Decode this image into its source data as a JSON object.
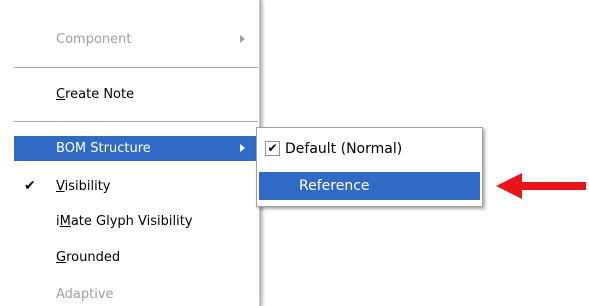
{
  "menu": {
    "items": [
      {
        "label_pre": "",
        "label_u": "",
        "label_post": "Component",
        "disabled": true,
        "submenu": true
      },
      {
        "label_pre": "",
        "label_u": "C",
        "label_post": "reate Note",
        "disabled": false
      },
      {
        "label": "BOM Structure",
        "highlighted": true,
        "submenu": true
      },
      {
        "label_pre": "",
        "label_u": "V",
        "label_post": "isibility",
        "checked": true,
        "check_glyph": "✔"
      },
      {
        "label_pre": "i",
        "label_u": "M",
        "label_post": "ate Glyph Visibility"
      },
      {
        "label_pre": "",
        "label_u": "G",
        "label_post": "rounded"
      },
      {
        "label_pre": "",
        "label_u": "",
        "label_post": "Adaptive",
        "disabled": true
      }
    ]
  },
  "submenu": {
    "items": [
      {
        "label": "Default (Normal)",
        "checked": true,
        "check_glyph": "✔"
      },
      {
        "label": "Reference",
        "highlighted": true
      }
    ]
  },
  "colors": {
    "highlight": "#316ac5",
    "disabled_text": "#a0a0a0",
    "arrow_red": "#e8141a"
  },
  "icons": {
    "submenu_arrow": "chevron-right-icon",
    "check": "checkmark-icon",
    "annotation": "red-arrow-icon"
  }
}
